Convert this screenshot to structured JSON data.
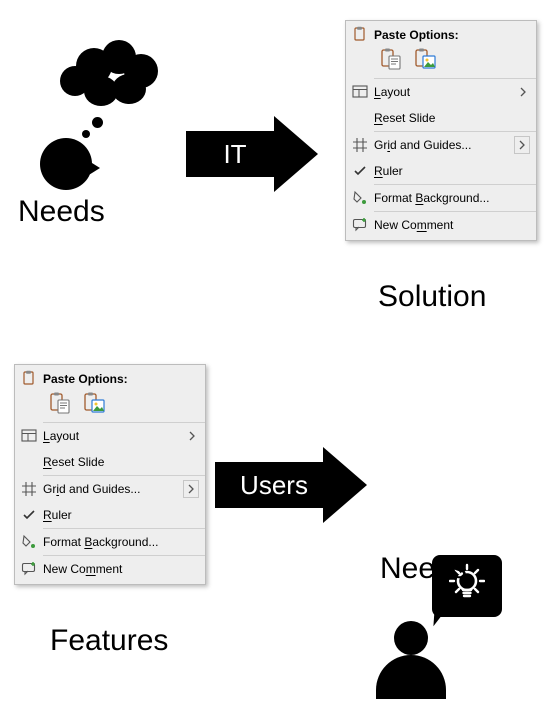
{
  "labels": {
    "needs_top": "Needs",
    "solution": "Solution",
    "features": "Features",
    "needs_bottom": "Needs"
  },
  "arrows": {
    "top": "IT",
    "bottom": "Users"
  },
  "context_menu": {
    "paste_header": "Paste Options:",
    "paste_option_1": "paste-keep-text",
    "paste_option_2": "paste-picture",
    "items": {
      "layout": {
        "pre": "",
        "u": "L",
        "post": "ayout",
        "has_sub": true
      },
      "reset": {
        "pre": "",
        "u": "R",
        "post": "eset Slide",
        "has_sub": false
      },
      "grid": {
        "pre": "Gr",
        "u": "i",
        "post": "d and Guides...",
        "has_sub": true,
        "boxed_chev": true
      },
      "ruler": {
        "pre": "",
        "u": "R",
        "post": "uler",
        "has_sub": false,
        "checked": true
      },
      "format": {
        "pre": "Format ",
        "u": "B",
        "post": "ackground...",
        "has_sub": false
      },
      "comment": {
        "pre": "New Co",
        "u": "m",
        "post": "ment",
        "has_sub": false
      }
    }
  }
}
